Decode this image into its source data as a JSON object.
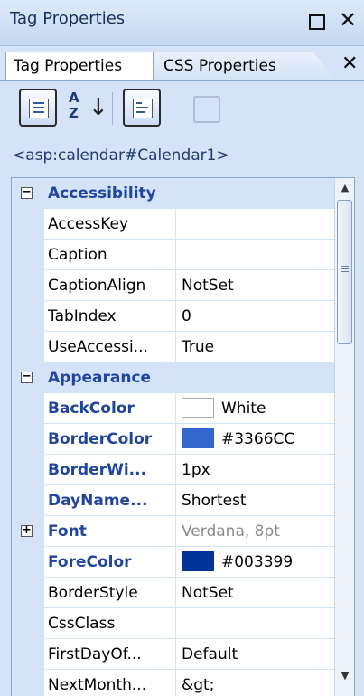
{
  "window": {
    "title": "Tag Properties"
  },
  "tabs": [
    {
      "label": "Tag Properties",
      "active": true
    },
    {
      "label": "CSS Properties",
      "active": false
    }
  ],
  "toolbar": {
    "categorized_icon": "categorized-icon",
    "alphabetical_icon": "alphabetical-sort-icon",
    "alphabetical_glyph": "A\nZ",
    "alphabetical_arrow": "↓",
    "properties_icon": "properties-icon",
    "events_icon": "events-icon"
  },
  "tag_label": "<asp:calendar#Calendar1>",
  "property_grid": {
    "categories": [
      {
        "name": "Accessibility",
        "expander": "−",
        "rows": [
          {
            "name": "AccessKey",
            "value": ""
          },
          {
            "name": "Caption",
            "value": ""
          },
          {
            "name": "CaptionAlign",
            "value": "NotSet"
          },
          {
            "name": "TabIndex",
            "value": "0"
          },
          {
            "name": "UseAccessi...",
            "value": "True"
          }
        ]
      },
      {
        "name": "Appearance",
        "expander": "−",
        "rows": [
          {
            "name": "BackColor",
            "value": "White",
            "modified": true,
            "swatch": "#ffffff"
          },
          {
            "name": "BorderColor",
            "value": "#3366CC",
            "modified": true,
            "swatch": "#3366CC"
          },
          {
            "name": "BorderWi...",
            "value": "1px",
            "modified": true
          },
          {
            "name": "DayName...",
            "value": "Shortest",
            "modified": true
          },
          {
            "name": "Font",
            "value": "Verdana, 8pt",
            "modified": true,
            "expander": "+"
          },
          {
            "name": "ForeColor",
            "value": "#003399",
            "modified": true,
            "swatch": "#003399"
          },
          {
            "name": "BorderStyle",
            "value": "NotSet"
          },
          {
            "name": "CssClass",
            "value": ""
          },
          {
            "name": "FirstDayOf...",
            "value": "Default"
          },
          {
            "name": "NextMonth...",
            "value": "&gt;"
          }
        ]
      }
    ]
  },
  "scrollbar": {
    "up_glyph": "▲",
    "down_glyph": "▼",
    "grip_icon": "scrollbar-grip-icon"
  },
  "window_buttons": {
    "restore_icon": "restore-icon",
    "close_icon": "close-icon",
    "close_glyph": "✕"
  },
  "tab_close_glyph": "✕"
}
